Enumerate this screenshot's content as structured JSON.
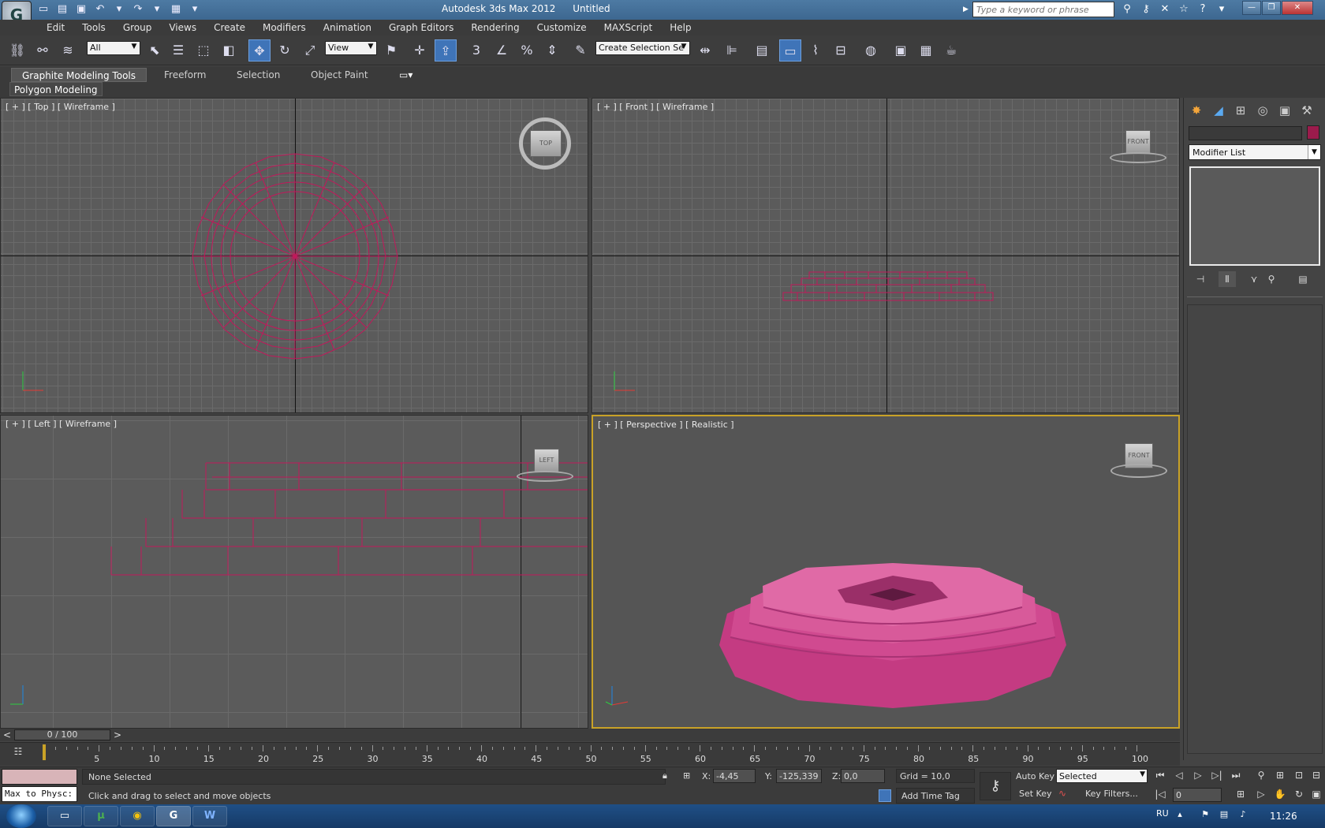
{
  "titlebar": {
    "app_name": "Autodesk 3ds Max  2012",
    "document": "Untitled",
    "search_placeholder": "Type a keyword or phrase",
    "logo_glyph": "G"
  },
  "menu": [
    "Edit",
    "Tools",
    "Group",
    "Views",
    "Create",
    "Modifiers",
    "Animation",
    "Graph Editors",
    "Rendering",
    "Customize",
    "MAXScript",
    "Help"
  ],
  "toolbar": {
    "selection_filter": "All",
    "ref_coord": "View",
    "named_selection": "Create Selection Se"
  },
  "ribbon": {
    "tabs": [
      "Graphite Modeling Tools",
      "Freeform",
      "Selection",
      "Object Paint"
    ],
    "panel": "Polygon Modeling"
  },
  "viewports": {
    "top": {
      "label": "[ + ] [ Top ] [ Wireframe ]",
      "cube": "TOP"
    },
    "front": {
      "label": "[ + ] [ Front ] [ Wireframe ]",
      "cube": "FRONT"
    },
    "left": {
      "label": "[ + ] [ Left ] [ Wireframe ]",
      "cube": "LEFT"
    },
    "perspective": {
      "label": "[ + ] [ Perspective ] [ Realistic ]",
      "cube": "FRONT"
    }
  },
  "command_panel": {
    "modifier_list": "Modifier List",
    "object_color": "#9b1b4c"
  },
  "timeline": {
    "slider": "0 / 100",
    "frame_current": 0,
    "frame_total": 100,
    "ticks": [
      "5",
      "10",
      "15",
      "20",
      "25",
      "30",
      "35",
      "40",
      "45",
      "50",
      "55",
      "60",
      "65",
      "70",
      "75",
      "80",
      "85",
      "90",
      "95",
      "100"
    ]
  },
  "status": {
    "maxscript_listener": "Max to Physc:",
    "selection": "None Selected",
    "prompt": "Click and drag to select and move objects",
    "x_label": "X:",
    "x_value": "-4,45",
    "y_label": "Y:",
    "y_value": "-125,339",
    "z_label": "Z:",
    "z_value": "0,0",
    "grid": "Grid = 10,0",
    "add_time_tag": "Add Time Tag",
    "auto_key": "Auto Key",
    "set_key": "Set Key",
    "key_mode": "Selected",
    "key_filters": "Key Filters...",
    "frame_field": "0"
  },
  "taskbar": {
    "lang": "RU",
    "clock": "11:26"
  },
  "colors": {
    "wire": "#c2185b",
    "shaded": "#d04a90",
    "accent": "#3f74b8"
  }
}
